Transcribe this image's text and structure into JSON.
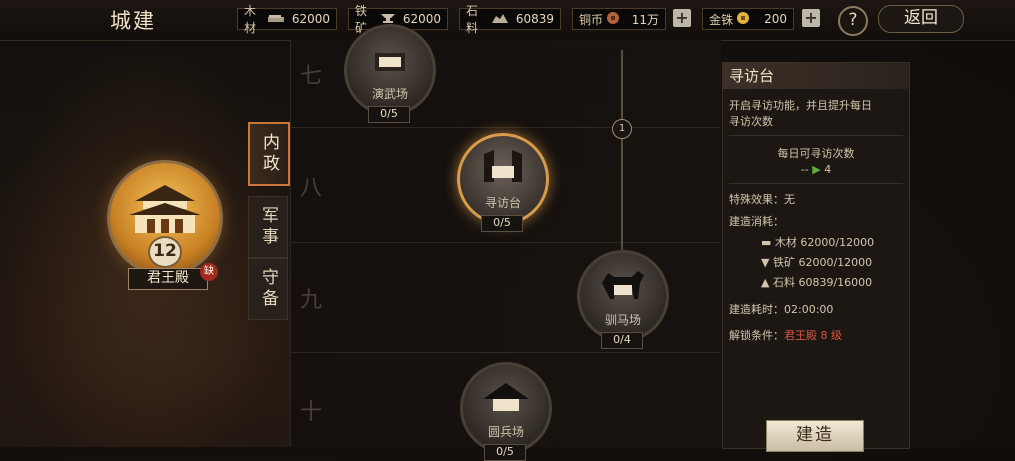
{
  "header": {
    "title": "城建",
    "resources": [
      {
        "name": "木材",
        "icon": "wood-icon",
        "value": "62000"
      },
      {
        "name": "铁矿",
        "icon": "anvil-icon",
        "value": "62000"
      },
      {
        "name": "石料",
        "icon": "stone-icon",
        "value": "60839"
      },
      {
        "name": "铜币",
        "icon": "copper-coin-icon",
        "value": "11万"
      },
      {
        "name": "金铢",
        "icon": "gold-coin-icon",
        "value": "200"
      }
    ],
    "help_label": "?",
    "back_label": "返回"
  },
  "palace": {
    "name": "君王殿",
    "level": "12",
    "lack_badge": "缺"
  },
  "tabs": [
    {
      "label": "内政",
      "active": true
    },
    {
      "label": "军事",
      "active": false
    },
    {
      "label": "守备",
      "active": false
    }
  ],
  "tree": {
    "rows": [
      "七",
      "八",
      "九",
      "十"
    ],
    "marker": "1",
    "nodes": [
      {
        "name": "演武场",
        "count": "0/5",
        "selected": false
      },
      {
        "name": "寻访台",
        "count": "0/5",
        "selected": true
      },
      {
        "name": "驯马场",
        "count": "0/4",
        "selected": false
      },
      {
        "name": "圆兵场",
        "count": "0/5",
        "selected": false
      }
    ]
  },
  "detail": {
    "title": "寻访台",
    "description_line1": "开启寻访功能，并且提升每日",
    "description_line2": "寻访次数",
    "stat_label": "每日可寻访次数",
    "stat_current": "--",
    "stat_next": "4",
    "special_effect": "特殊效果：无",
    "cost_label": "建造消耗：",
    "costs": [
      {
        "name": "木材",
        "value": "62000/12000"
      },
      {
        "name": "铁矿",
        "value": "62000/12000"
      },
      {
        "name": "石料",
        "value": "60839/16000"
      }
    ],
    "build_time": "建造耗时：02:00:00",
    "unlock_label": "解锁条件：",
    "unlock_value": "君王殿 8 级",
    "build_button": "建造"
  }
}
